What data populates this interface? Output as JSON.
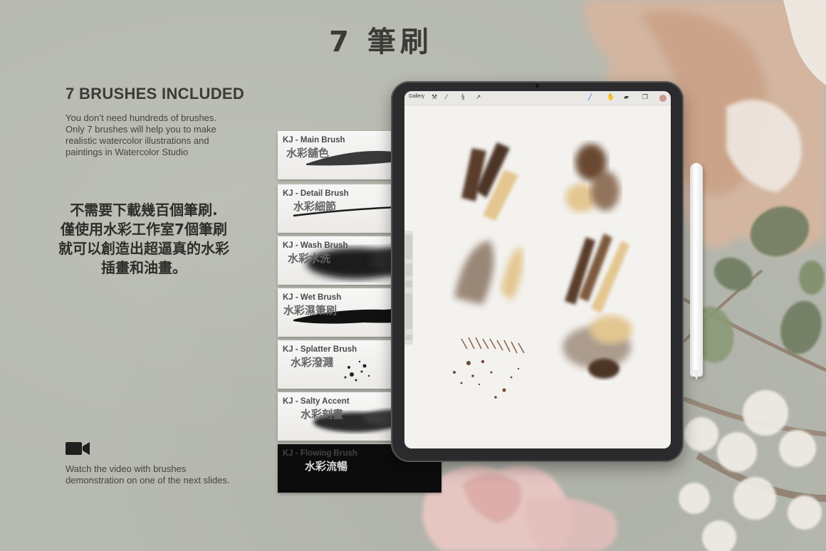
{
  "header": {
    "title": "7 筆刷"
  },
  "intro": {
    "heading": "7 BRUSHES INCLUDED",
    "description": "You don’t need hundreds of brushes.  Only 7 brushes will help you to make realistic watercolor illustrations and paintings in Watercolor Studio",
    "zh_line1": "不需要下載幾百個筆刷.",
    "zh_line2": "僅使用水彩工作室7個筆刷",
    "zh_line3": "就可以創造出超逼真的水彩",
    "zh_line4": "插畫和油畫。"
  },
  "video": {
    "icon": "video-camera-icon",
    "note": "Watch the video with brushes demonstration on one of the next slides."
  },
  "brushes": [
    {
      "name": "KJ - Main Brush",
      "zh": "水彩舖色"
    },
    {
      "name": "KJ - Detail Brush",
      "zh": "水彩細節"
    },
    {
      "name": "KJ - Wash Brush",
      "zh": "水彩水洗"
    },
    {
      "name": "KJ - Wet Brush",
      "zh": "水彩濕筆刷"
    },
    {
      "name": "KJ - Splatter Brush",
      "zh": "水彩潑濺"
    },
    {
      "name": "KJ - Salty Accent",
      "zh": "水彩刻畫"
    },
    {
      "name": "KJ - Flowing Brush",
      "zh": "水彩流暢"
    }
  ],
  "app": {
    "gallery_label": "Gallery",
    "toolbar_icons": [
      "wrench-icon",
      "magic-wand-icon",
      "selection-icon",
      "transform-arrow-icon",
      "brush-icon",
      "smudge-icon",
      "eraser-icon",
      "layers-icon",
      "color-swatch-icon"
    ]
  },
  "colors": {
    "background": "#b7bab0",
    "brown_dark": "#5a3d2b",
    "ochre": "#e3c690",
    "taupe": "#9a8777",
    "blush": "#e9c7c3",
    "sage": "#6f7d60"
  }
}
